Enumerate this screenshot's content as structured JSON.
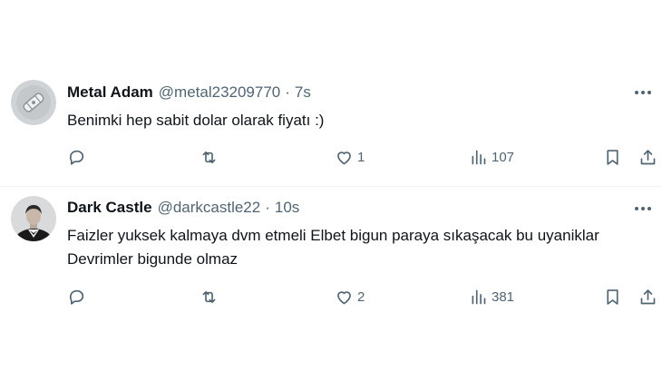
{
  "tweets": [
    {
      "name": "Metal Adam",
      "handle": "@metal23209770",
      "separator": "·",
      "time": "7s",
      "text": "Benimki hep sabit dolar olarak fiyatı :)",
      "replies": "",
      "retweets": "",
      "likes": "1",
      "views": "107",
      "avatar": "default-avatar-icon"
    },
    {
      "name": "Dark Castle",
      "handle": "@darkcastle22",
      "separator": "·",
      "time": "10s",
      "text": "Faizler yuksek kalmaya dvm etmeli Elbet bigun paraya sıkaşacak bu uyaniklar Devrimler bigunde olmaz",
      "replies": "",
      "retweets": "",
      "likes": "2",
      "views": "381",
      "avatar": "portrait-avatar"
    }
  ],
  "colors": {
    "text": "#0f1419",
    "secondary": "#536471",
    "divider": "#eff3f4"
  }
}
